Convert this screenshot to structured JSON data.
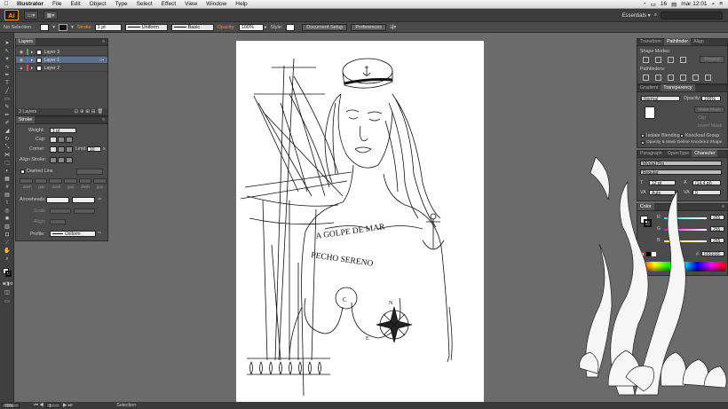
{
  "menubar": {
    "apple": "",
    "app_name": "Illustrator",
    "items": [
      "File",
      "Edit",
      "Object",
      "Type",
      "Select",
      "Effect",
      "View",
      "Window",
      "Help"
    ],
    "status_battery": "16",
    "status_clock": "mar 12:01"
  },
  "appbar": {
    "logo": "Ai",
    "workspace": "Essentials ▾"
  },
  "control": {
    "selection": "No Selection",
    "stroke_label": "Stroke",
    "stroke_weight": "1 pt",
    "profile": "Uniform",
    "brush": "Basic",
    "opacity_label": "Opacity:",
    "opacity": "100%",
    "style_label": "Style:",
    "doc_setup": "Document Setup",
    "preferences": "Preferences"
  },
  "layers": {
    "tab": "Layers",
    "rows": [
      {
        "name": "Layer 3",
        "color": "#4fb14f"
      },
      {
        "name": "Layer 1",
        "color": "#4f79d6"
      },
      {
        "name": "Layer 2",
        "color": "#d64f4f"
      }
    ],
    "footer": "3 Layers"
  },
  "stroke_panel": {
    "tab": "Stroke",
    "weight_label": "Weight:",
    "weight": "1 pt",
    "cap_label": "Cap:",
    "corner_label": "Corner:",
    "limit_label": "Limit:",
    "limit": "10",
    "limit_unit": "x",
    "align_label": "Align Stroke:",
    "dashed_label": "Dashed Line",
    "dash_labels": [
      "dash",
      "gap",
      "dash",
      "gap",
      "dash",
      "gap"
    ],
    "arrowheads_label": "Arrowheads:",
    "scale_label": "Scale:",
    "align2_label": "Align:",
    "profile_label": "Profile:",
    "profile": "Uniform"
  },
  "transform_panel": {
    "tabs": [
      "Transform",
      "Pathfinder",
      "Align"
    ],
    "shape_modes": "Shape Modes:",
    "expand": "Expand",
    "pathfinders": "Pathfinders:"
  },
  "transparency_panel": {
    "tabs": [
      "Gradient",
      "Transparency"
    ],
    "blend": "Normal",
    "opacity_label": "Opacity:",
    "opacity": "100%",
    "make_mask": "Make Mask",
    "clip": "Clip",
    "invert_mask": "Invert Mask",
    "isolate": "Isolate Blending",
    "knockout": "Knockout Group",
    "opacity_mask": "Opacity & Mask Define Knockout Shape"
  },
  "character_panel": {
    "tabs": [
      "Paragraph",
      "OpenType",
      "Character"
    ],
    "font": "Myriad Pro",
    "style": "Regular",
    "size": "12 pt",
    "leading": "(14,4 pt)",
    "tracking": "Auto",
    "kerning": "0"
  },
  "color_panel": {
    "tab": "Color",
    "channels": [
      {
        "label": "R",
        "value": "255",
        "color": "#e23a3a"
      },
      {
        "label": "G",
        "value": "255",
        "color": "#3ad23a"
      },
      {
        "label": "B",
        "value": "255",
        "color": "#3a5ae2"
      }
    ],
    "hex_prefix": "#",
    "hex": "FFFFFF"
  },
  "artwork": {
    "text_line1": "A GOLPE DE MAR",
    "text_line2": "PECHO SERENO",
    "compass_n": "N",
    "compass_e": "E",
    "tattoo_c": "C"
  },
  "status": {
    "zoom": "70%",
    "page": "1",
    "tool": "Selection"
  }
}
